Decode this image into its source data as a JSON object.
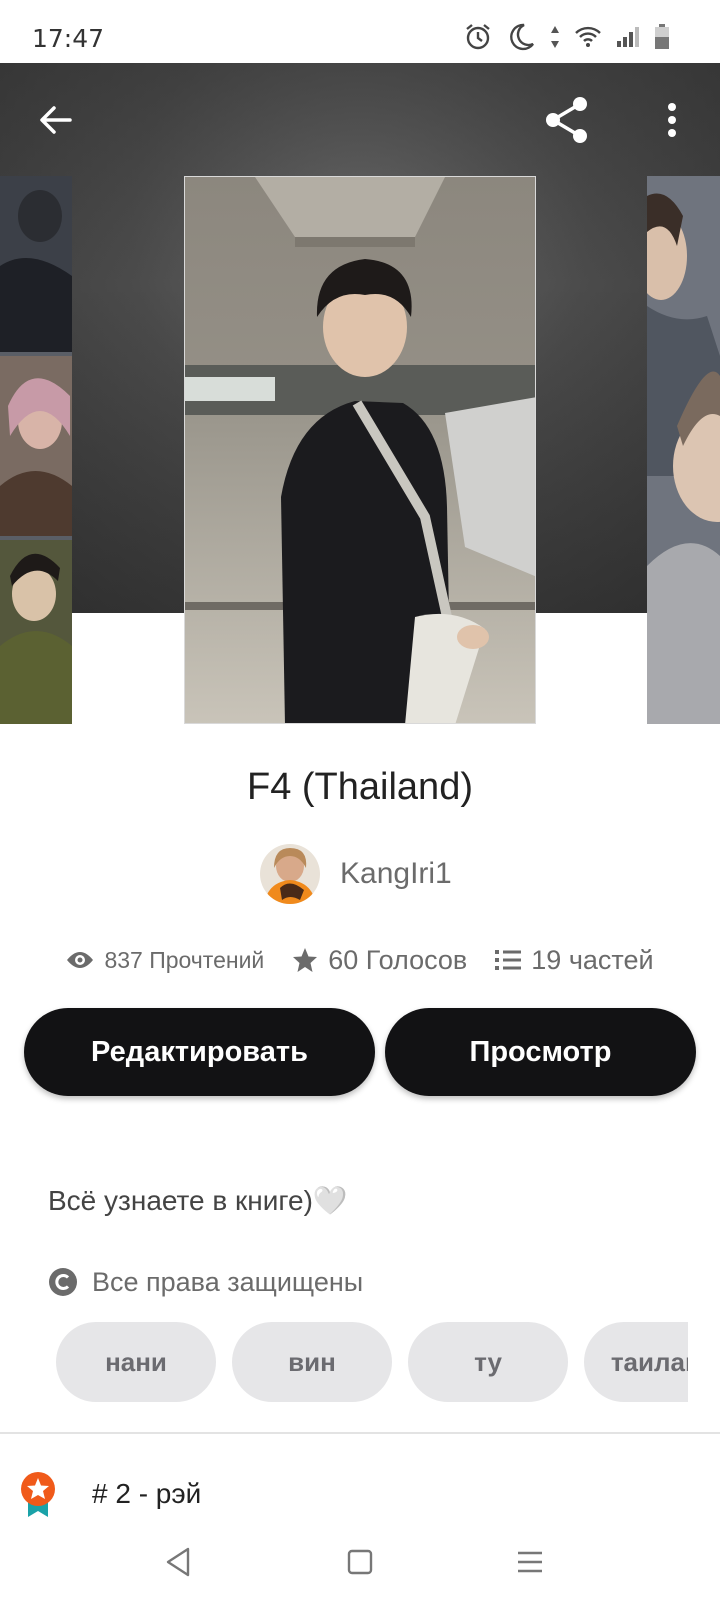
{
  "status_bar": {
    "time": "17:47",
    "icons": [
      "alarm-icon",
      "moon-icon",
      "data-arrows-icon",
      "wifi-icon",
      "signal-icon",
      "battery-icon"
    ]
  },
  "toolbar": {
    "back_icon": "arrow-left-icon",
    "share_icon": "share-icon",
    "more_icon": "more-vertical-icon"
  },
  "book": {
    "title": "F4 (Thailand)",
    "author": "KangIri1",
    "stats": {
      "reads": "837 Прочтений",
      "votes": "60 Голосов",
      "parts": "19 частей"
    },
    "description": "Всё узнаете в книге)🤍",
    "rights": "Все права защищены",
    "tags": [
      "нани",
      "вин",
      "ту",
      "таиланд"
    ]
  },
  "actions": {
    "edit_label": "Редактировать",
    "preview_label": "Просмотр"
  },
  "ranking": {
    "label": "# 2 - рэй"
  },
  "colors": {
    "button_bg": "#121214",
    "tag_bg": "#e6e6e8",
    "badge_orange": "#f05a1a",
    "badge_teal": "#1aa2a8"
  }
}
